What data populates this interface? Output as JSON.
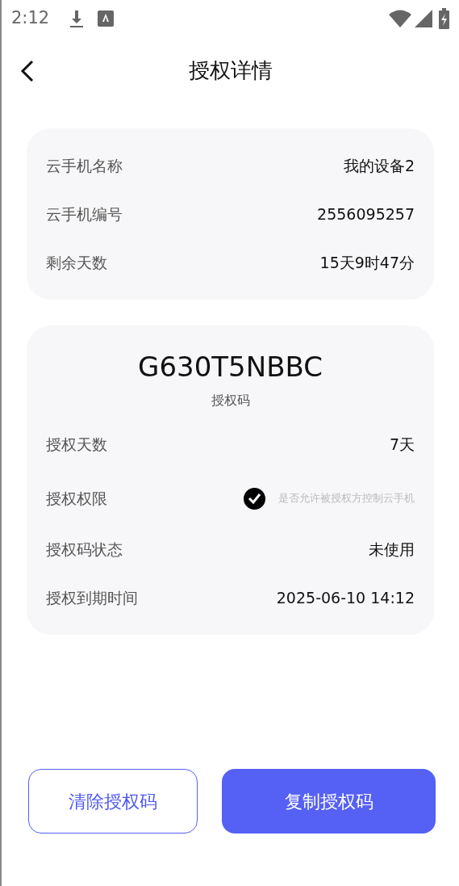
{
  "status_bar": {
    "time": "2:12"
  },
  "header": {
    "title": "授权详情"
  },
  "device_info": [
    {
      "label": "云手机名称",
      "value": "我的设备2"
    },
    {
      "label": "云手机编号",
      "value": "2556095257"
    },
    {
      "label": "剩余天数",
      "value": "15天9时47分"
    }
  ],
  "auth": {
    "code": "G630T5NBBC",
    "code_label": "授权码",
    "rows": [
      {
        "kind": "text",
        "label": "授权天数",
        "value": "7天"
      },
      {
        "kind": "checkbox",
        "label": "授权权限",
        "checked": true,
        "value": "是否允许被授权方控制云手机"
      },
      {
        "kind": "text",
        "label": "授权码状态",
        "value": "未使用"
      },
      {
        "kind": "text",
        "label": "授权到期时间",
        "value": "2025-06-10 14:12"
      }
    ]
  },
  "buttons": [
    {
      "kind": "outline",
      "label": "清除授权码"
    },
    {
      "kind": "filled",
      "label": "复制授权码"
    }
  ]
}
